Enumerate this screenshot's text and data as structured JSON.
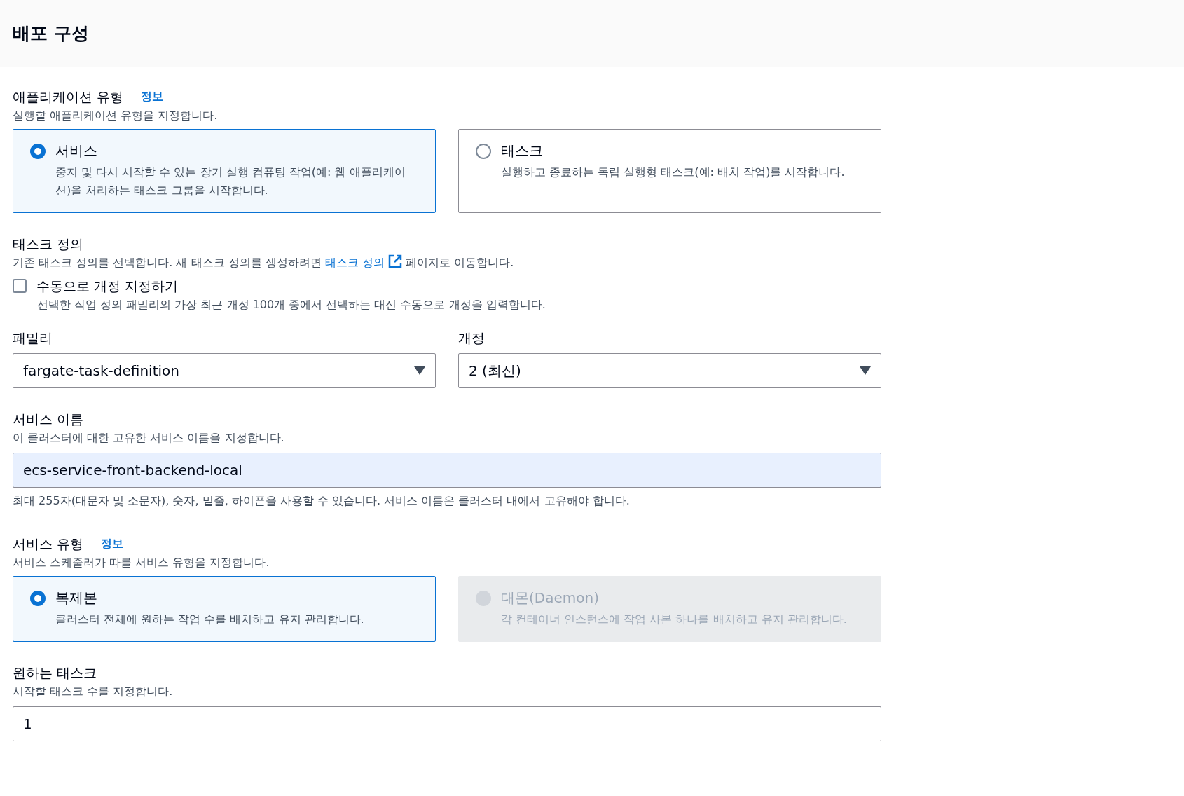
{
  "section_title": "배포 구성",
  "application_type": {
    "label": "애플리케이션 유형",
    "info": "정보",
    "description": "실행할 애플리케이션 유형을 지정합니다.",
    "options": [
      {
        "title": "서비스",
        "description": "중지 및 다시 시작할 수 있는 장기 실행 컴퓨팅 작업(예: 웹 애플리케이션)을 처리하는 태스크 그룹을 시작합니다.",
        "selected": true,
        "disabled": false
      },
      {
        "title": "태스크",
        "description": "실행하고 종료하는 독립 실행형 태스크(예: 배치 작업)를 시작합니다.",
        "selected": false,
        "disabled": false
      }
    ]
  },
  "task_definition": {
    "label": "태스크 정의",
    "description_before": "기존 태스크 정의를 선택합니다. 새 태스크 정의를 생성하려면",
    "link": "태스크 정의",
    "description_after": "페이지로 이동합니다.",
    "manual_revision": {
      "label": "수동으로 개정 지정하기",
      "checked": false,
      "description": "선택한 작업 정의 패밀리의 가장 최근 개정 100개 중에서 선택하는 대신 수동으로 개정을 입력합니다."
    },
    "family": {
      "label": "패밀리",
      "value": "fargate-task-definition"
    },
    "revision": {
      "label": "개정",
      "value": "2 (최신)"
    }
  },
  "service_name": {
    "label": "서비스 이름",
    "description": "이 클러스터에 대한 고유한 서비스 이름을 지정합니다.",
    "value": "ecs-service-front-backend-local",
    "autofilled": true,
    "constraint": "최대 255자(대문자 및 소문자), 숫자, 밑줄, 하이픈을 사용할 수 있습니다. 서비스 이름은 클러스터 내에서 고유해야 합니다."
  },
  "service_type": {
    "label": "서비스 유형",
    "info": "정보",
    "description": "서비스 스케줄러가 따를 서비스 유형을 지정합니다.",
    "options": [
      {
        "title": "복제본",
        "description": "클러스터 전체에 원하는 작업 수를 배치하고 유지 관리합니다.",
        "selected": true,
        "disabled": false
      },
      {
        "title": "대몬(Daemon)",
        "description": "각 컨테이너 인스턴스에 작업 사본 하나를 배치하고 유지 관리합니다.",
        "selected": false,
        "disabled": true
      }
    ]
  },
  "desired_tasks": {
    "label": "원하는 태스크",
    "description": "시작할 태스크 수를 지정합니다.",
    "value": "1",
    "autofilled": false
  }
}
